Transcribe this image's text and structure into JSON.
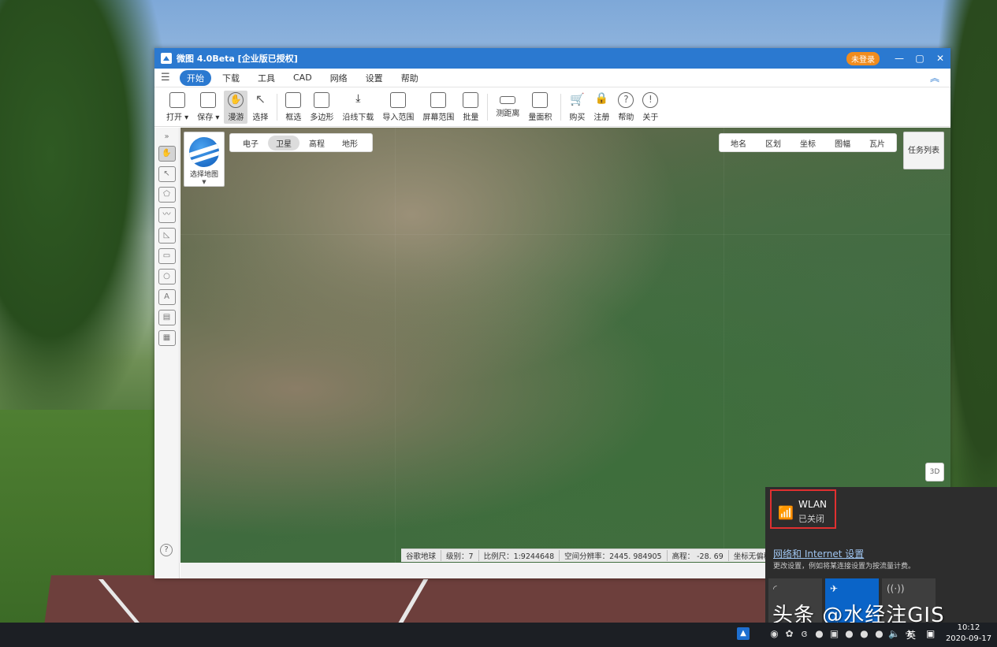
{
  "window": {
    "title": "微图 4.0Beta [企业版已授权]",
    "login_badge": "未登录",
    "minimize": "—",
    "maximize": "▢",
    "close": "✕"
  },
  "menu": {
    "items": [
      "开始",
      "下载",
      "工具",
      "CAD",
      "网络",
      "设置",
      "帮助"
    ],
    "active": "开始"
  },
  "ribbon": {
    "buttons": [
      "打开 ▾",
      "保存 ▾",
      "漫游",
      "选择",
      "框选",
      "多边形",
      "沿线下载",
      "导入范围",
      "屏幕范围",
      "批量",
      "测距离",
      "量面积",
      "购买",
      "注册",
      "帮助",
      "关于"
    ]
  },
  "map": {
    "select_label": "选择地图",
    "types": [
      "电子",
      "卫星",
      "高程",
      "地形"
    ],
    "active_type": "卫星",
    "layer_tabs": [
      "地名",
      "区划",
      "坐标",
      "图幅",
      "瓦片"
    ],
    "task_list": "任务列表",
    "btn_3d": "3D"
  },
  "status_bar": {
    "source": "谷歌地球",
    "level": "级别：7",
    "scale": "比例尺：1:9244648",
    "resolution": "空间分辨率：2445. 984905",
    "elevation": "高程：    -28. 69",
    "coord": "坐标无偏移"
  },
  "flyout": {
    "wlan_title": "WLAN",
    "wlan_status": "已关闭",
    "settings_link": "网络和 Internet 设置",
    "settings_desc": "更改设置，例如将某连接设置为按流量计费。"
  },
  "taskbar": {
    "ime": "英",
    "time": "10:12",
    "date": "2020-09-17"
  },
  "watermark": "头条 @水经注GIS"
}
